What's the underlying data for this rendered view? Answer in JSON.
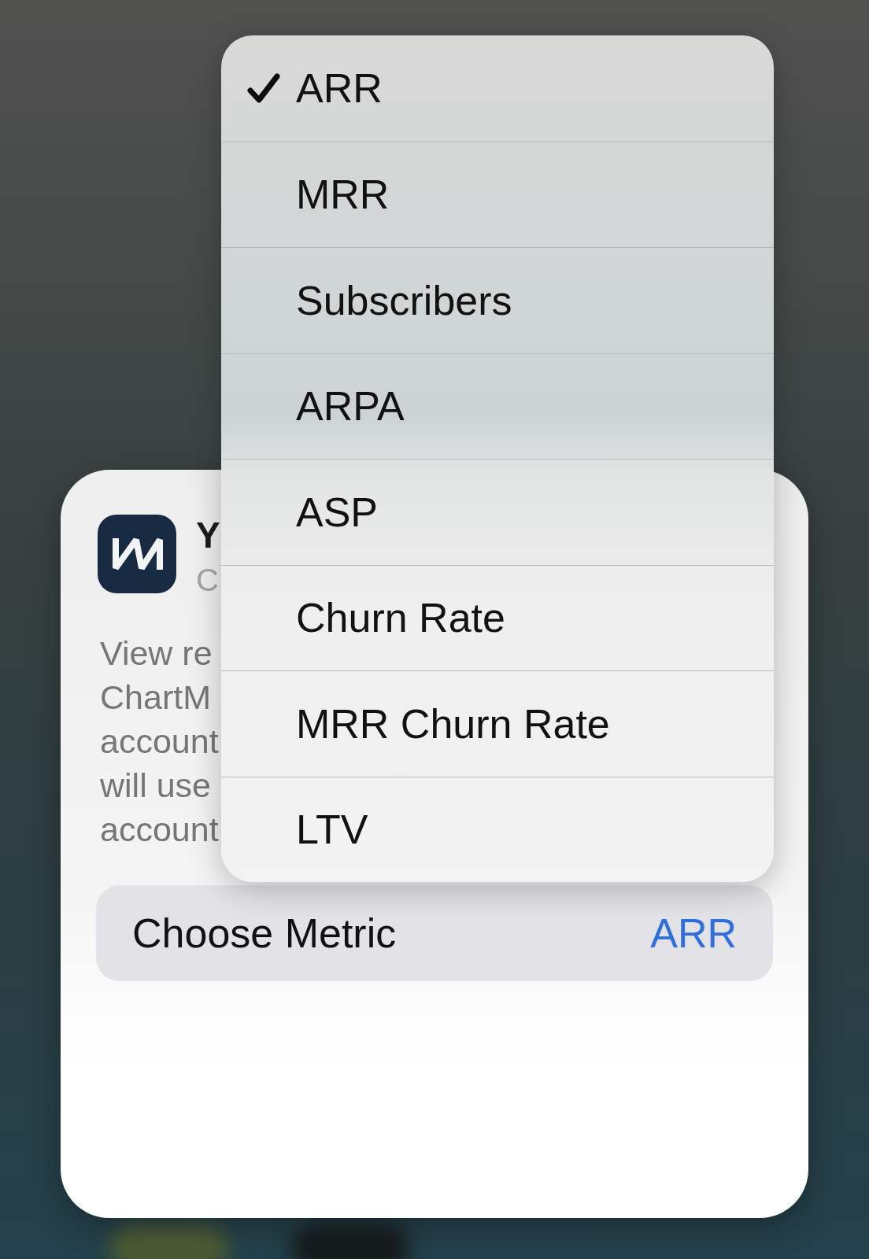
{
  "menu": {
    "items": [
      {
        "label": "ARR",
        "selected": true
      },
      {
        "label": "MRR",
        "selected": false
      },
      {
        "label": "Subscribers",
        "selected": false
      },
      {
        "label": "ARPA",
        "selected": false
      },
      {
        "label": "ASP",
        "selected": false
      },
      {
        "label": "Churn Rate",
        "selected": false
      },
      {
        "label": "MRR Churn Rate",
        "selected": false
      },
      {
        "label": "LTV",
        "selected": false
      }
    ]
  },
  "widget": {
    "title": "Y",
    "subtitle": "C",
    "description_lines": [
      "View re",
      "ChartM",
      "account",
      "will use",
      "account"
    ],
    "setting": {
      "label": "Choose Metric",
      "value": "ARR"
    }
  }
}
